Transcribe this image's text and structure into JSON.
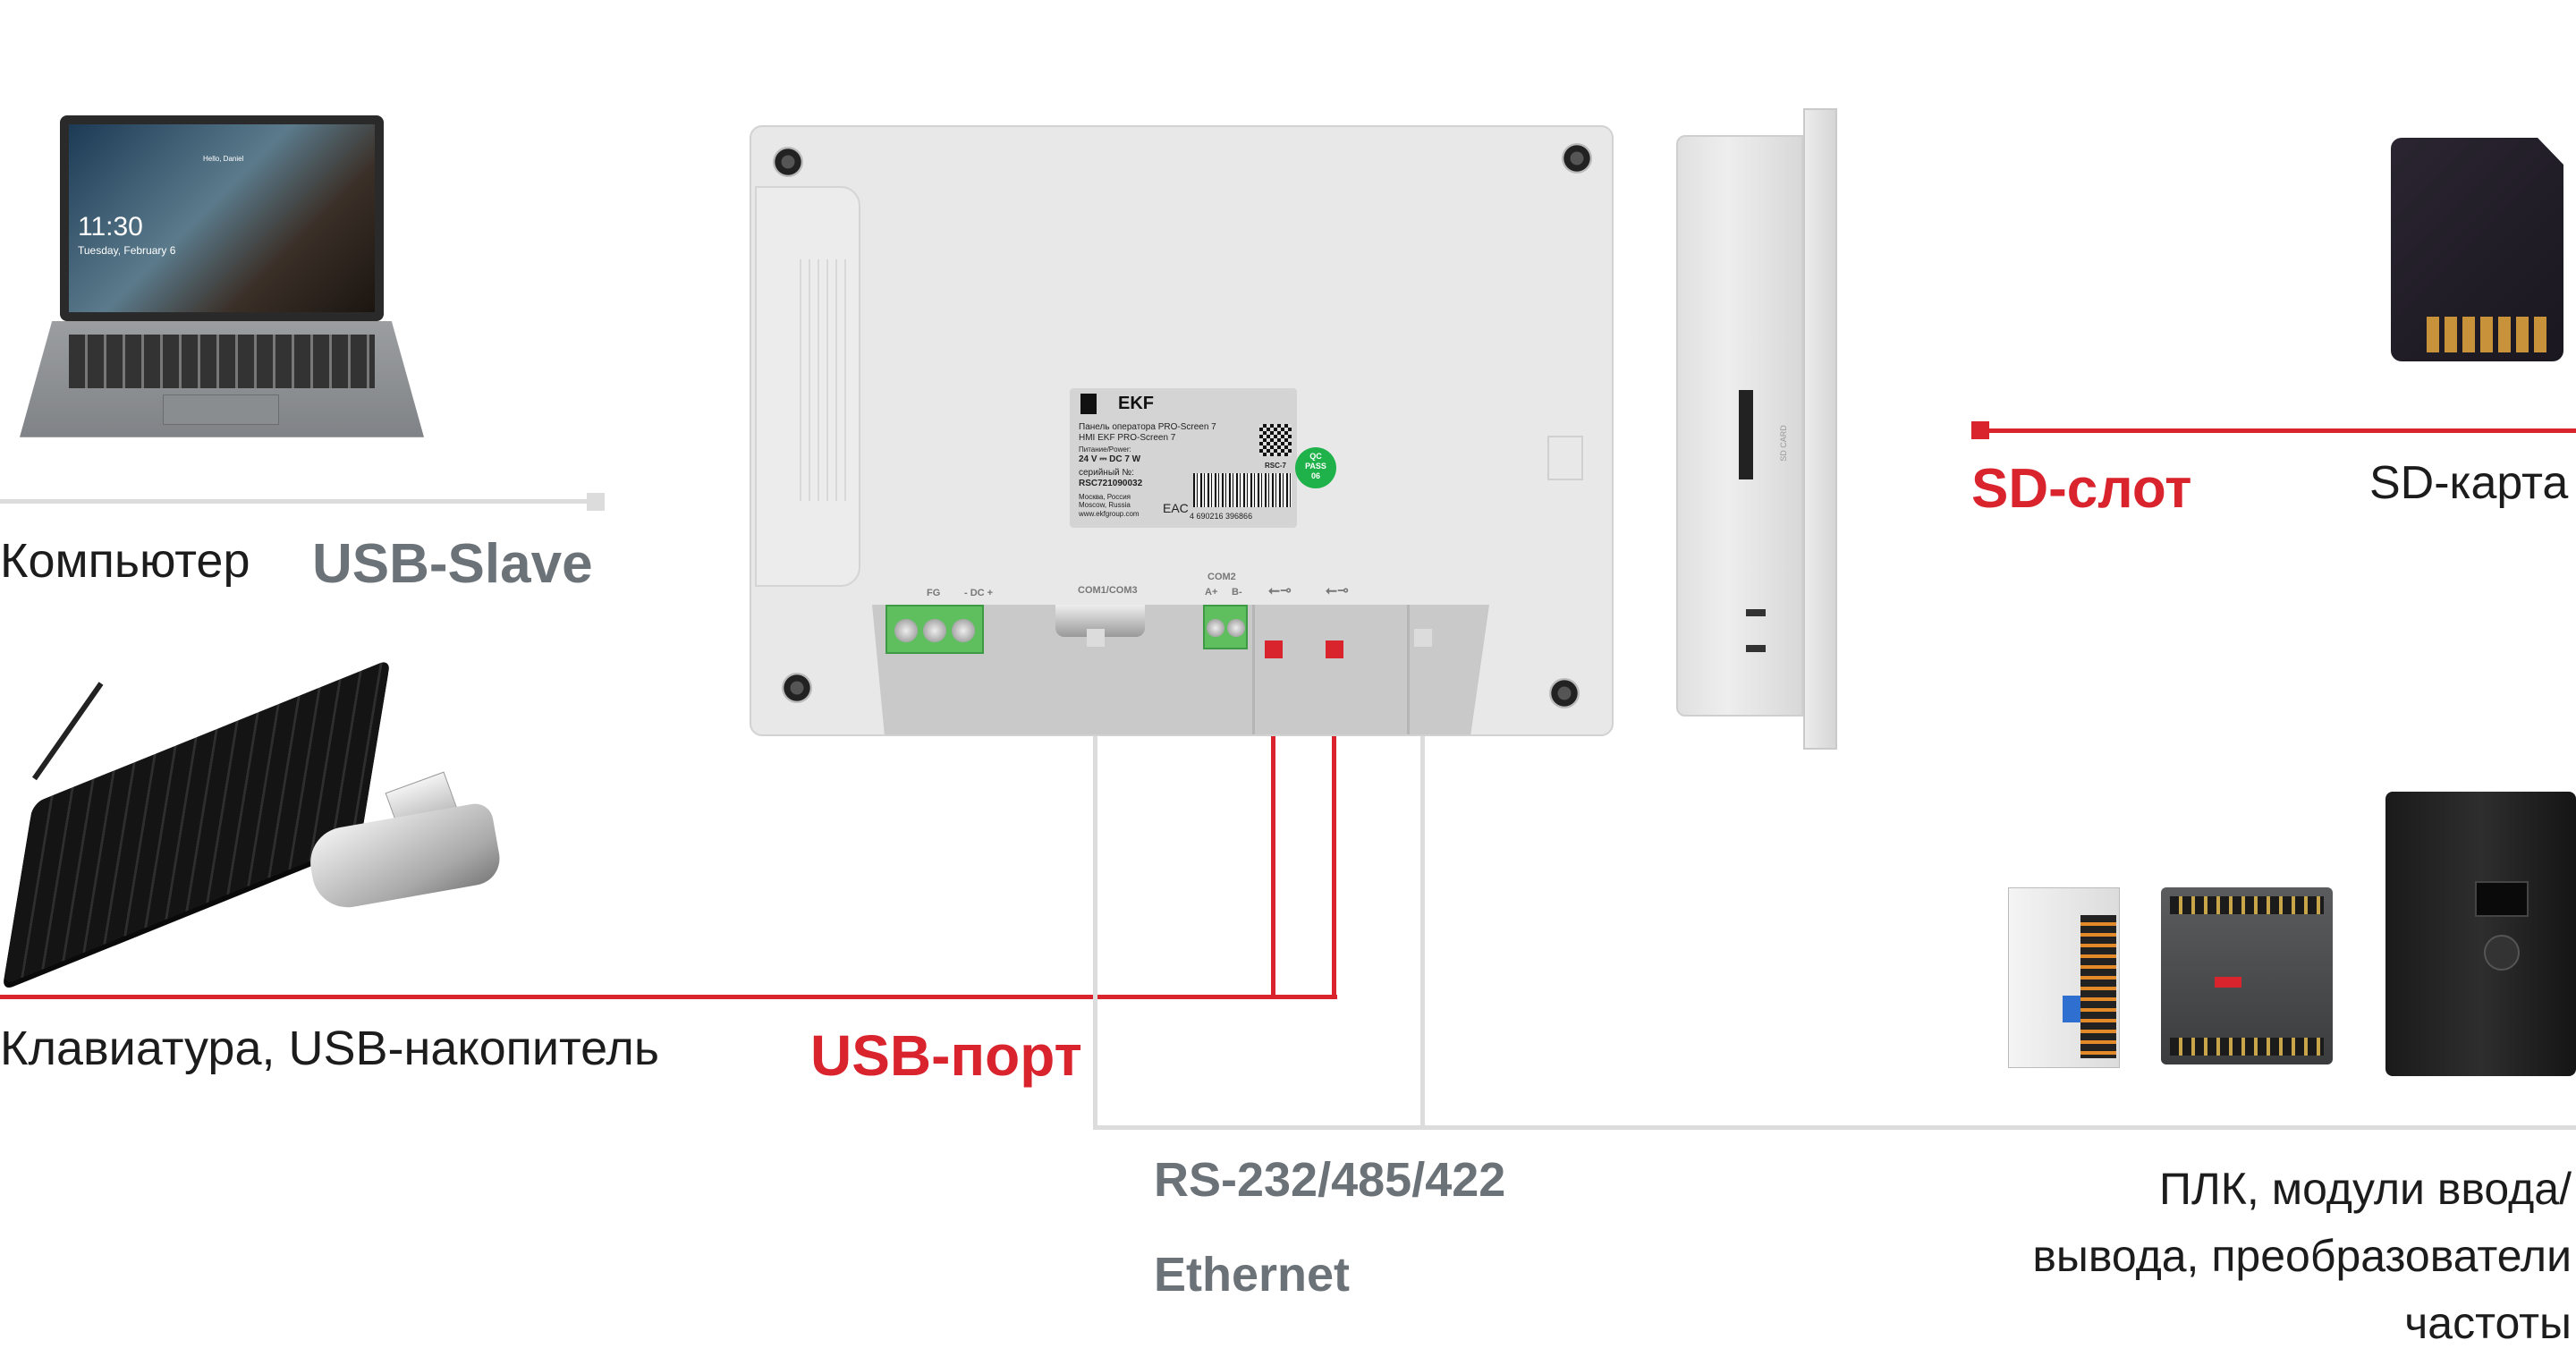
{
  "left": {
    "computer_label": "Компьютер",
    "usb_slave_label": "USB-Slave",
    "keyboard_label": "Клавиатура,  USB-накопитель",
    "laptop_screen": {
      "time": "11:30",
      "date": "Tuesday, February 6",
      "greeting": "Hello, Daniel"
    }
  },
  "center": {
    "usb_port_label": "USB-порт",
    "rs_label": "RS-232/485/422",
    "ethernet_label": "Ethernet",
    "ports": {
      "fg": "FG",
      "dc": "- DC +",
      "com13": "COM1/COM3",
      "com2": "COM2",
      "a_plus": "A+",
      "b_minus": "B-"
    },
    "side_sd_text": "SD CARD",
    "nameplate": {
      "brand": "EKF",
      "line1": "Панель оператора PRO-Screen 7",
      "line2": "HMI EKF PRO-Screen 7",
      "power_label": "Питание/Power:",
      "power_value": "24 V ⎓ DC  7 W",
      "serial_label": "серийный №:",
      "serial": "RSC721090032",
      "city_ru": "Москва, Россия",
      "city_en": "Moscow, Russia",
      "website": "www.ekfgroup.com",
      "model": "RSC-7",
      "barcode": "4 690216 396866",
      "cert": "EAC",
      "qc": [
        "QC",
        "PASS",
        "06"
      ]
    }
  },
  "right": {
    "sd_slot_label": "SD-слот",
    "sd_card_label": "SD-карта",
    "devices_label": [
      "ПЛК, модули ввода/",
      "вывода, преобразователи",
      "частоты"
    ]
  },
  "colors": {
    "accent_red": "#d9232d",
    "label_gray": "#6b7278",
    "line_gray": "#dcdcdc",
    "terminal_green": "#5fbf5f"
  }
}
